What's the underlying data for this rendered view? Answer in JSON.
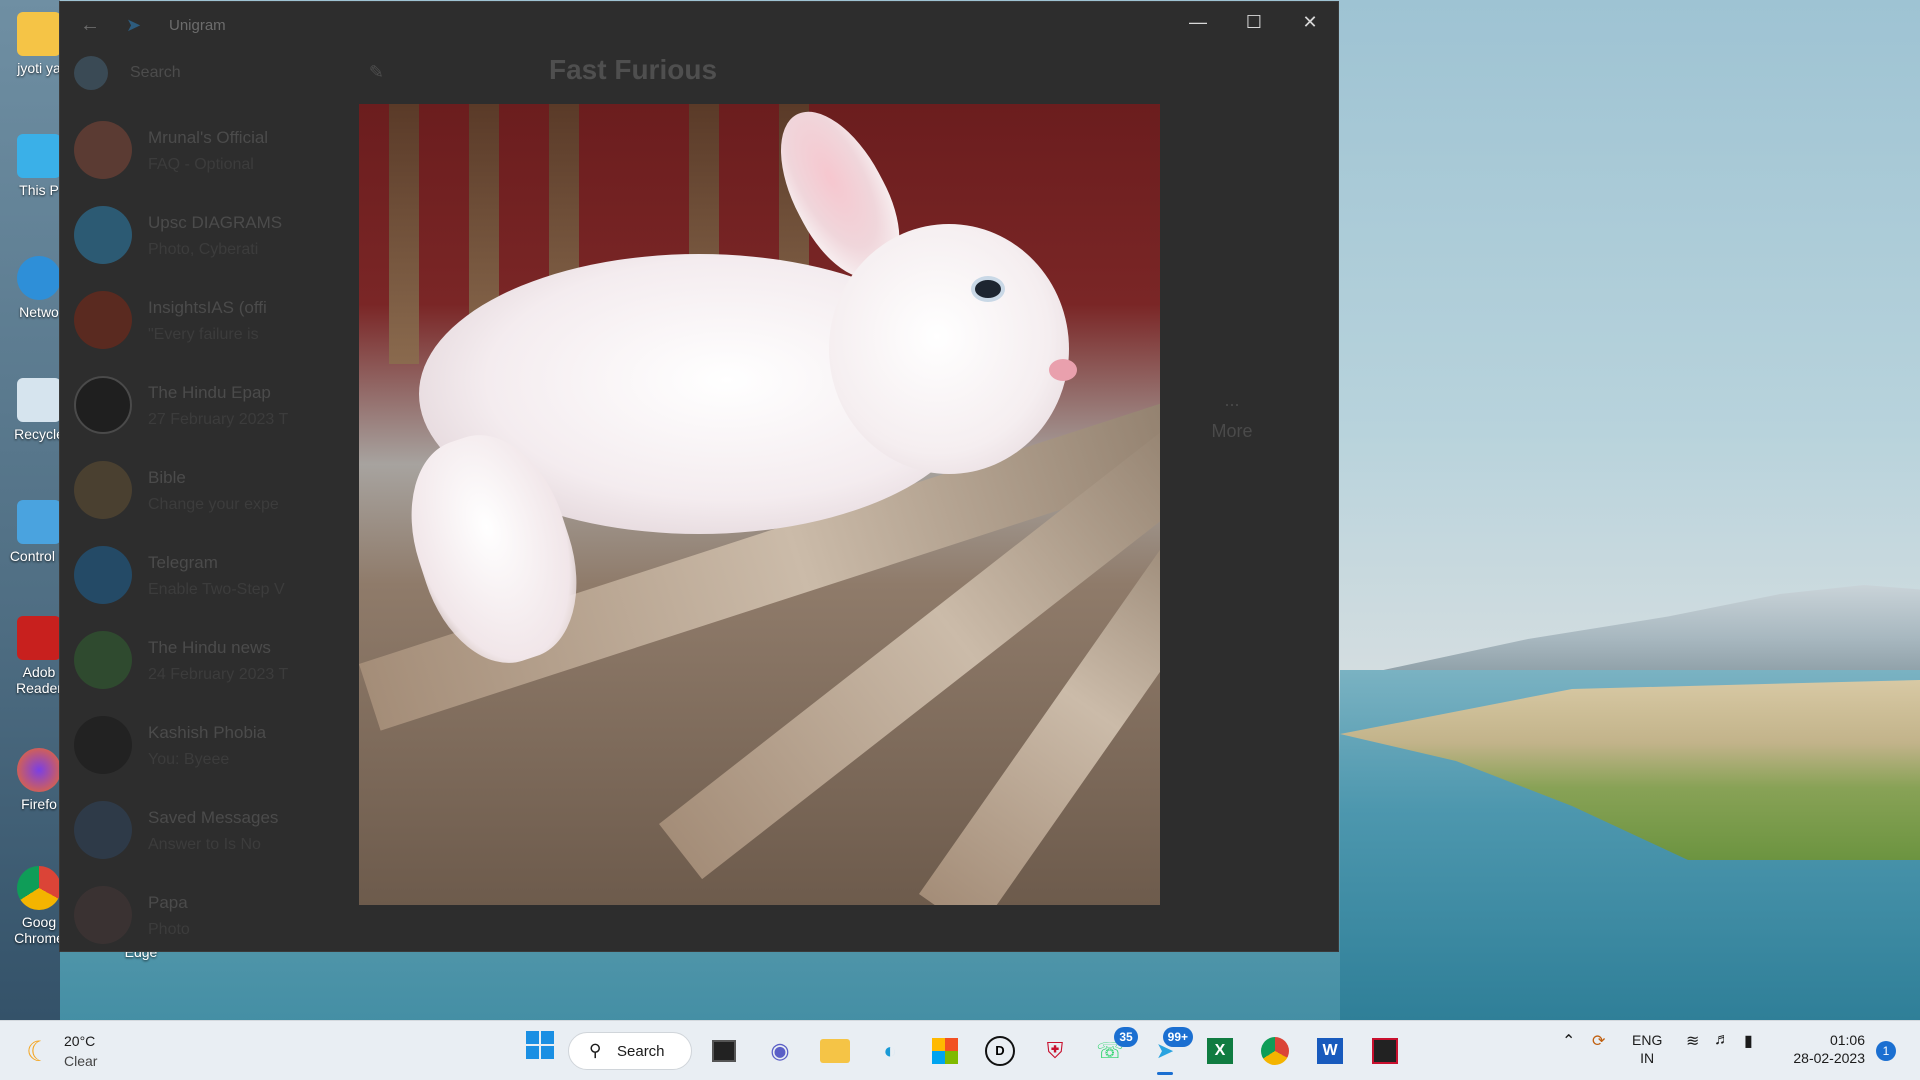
{
  "desktop": {
    "icons": [
      {
        "label": "jyoti ya"
      },
      {
        "label": "This P"
      },
      {
        "label": "Netwo"
      },
      {
        "label": "Recycle"
      },
      {
        "label": "Control P"
      },
      {
        "label": "Adob Reader"
      },
      {
        "label": "Firefo"
      },
      {
        "label": "Goog Chrome"
      },
      {
        "label": "Edge"
      }
    ]
  },
  "window": {
    "app_title": "Unigram",
    "search_placeholder": "Search",
    "chat_title": "Fast Furious",
    "more_label": "More",
    "more_dots": "...",
    "chats": [
      {
        "name": "Mrunal's Official",
        "preview": "FAQ - Optional"
      },
      {
        "name": "Upsc DIAGRAMS",
        "preview": "Photo, Cyberati"
      },
      {
        "name": "InsightsIAS (offi",
        "preview": "\"Every failure is"
      },
      {
        "name": "The Hindu Epap",
        "preview": "27 February 2023 T"
      },
      {
        "name": "Bible",
        "preview": "Change your expe"
      },
      {
        "name": "Telegram",
        "preview": "Enable Two-Step V"
      },
      {
        "name": "The Hindu news",
        "preview": "24 February 2023 T"
      },
      {
        "name": "Kashish Phobia",
        "preview": "You: Byeee"
      },
      {
        "name": "Saved Messages",
        "preview": "Answer to Is No"
      },
      {
        "name": "Papa",
        "preview": "Photo"
      }
    ]
  },
  "taskbar": {
    "weather_temp": "20°C",
    "weather_condition": "Clear",
    "search_label": "Search",
    "whatsapp_badge": "35",
    "telegram_badge": "99+",
    "lang_line1": "ENG",
    "lang_line2": "IN",
    "time": "01:06",
    "date": "28-02-2023",
    "notification_count": "1"
  }
}
